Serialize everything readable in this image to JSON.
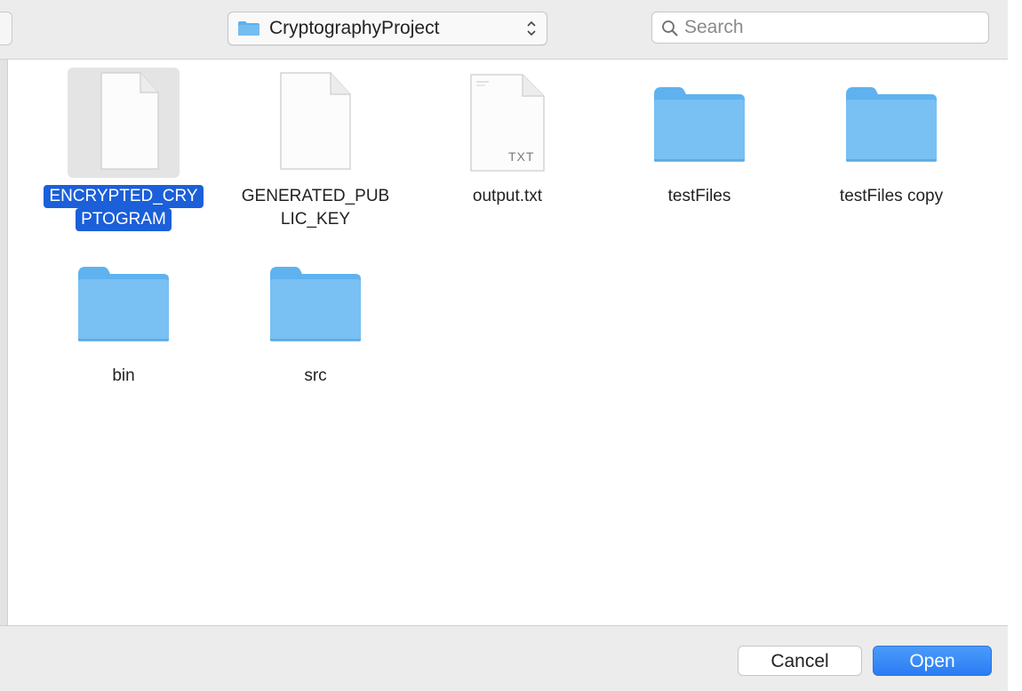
{
  "toolbar": {
    "location": "CryptographyProject",
    "search_placeholder": "Search"
  },
  "items": [
    {
      "name_lines": [
        "ENCRYPTED_CRY",
        "PTOGRAM"
      ],
      "kind": "document",
      "selected": true
    },
    {
      "name_lines": [
        "GENERATED_PUB",
        "LIC_KEY"
      ],
      "kind": "document",
      "selected": false
    },
    {
      "name_lines": [
        "output.txt"
      ],
      "kind": "text-file",
      "badge": "TXT",
      "selected": false
    },
    {
      "name_lines": [
        "testFiles"
      ],
      "kind": "folder",
      "selected": false
    },
    {
      "name_lines": [
        "testFiles copy"
      ],
      "kind": "folder",
      "selected": false
    },
    {
      "name_lines": [
        "bin"
      ],
      "kind": "folder",
      "selected": false
    },
    {
      "name_lines": [
        "src"
      ],
      "kind": "folder",
      "selected": false
    }
  ],
  "buttons": {
    "cancel": "Cancel",
    "open": "Open"
  },
  "colors": {
    "selection": "#1b5fd9",
    "folder": "#74bdf1",
    "primary_button": "#3a8cf8"
  }
}
